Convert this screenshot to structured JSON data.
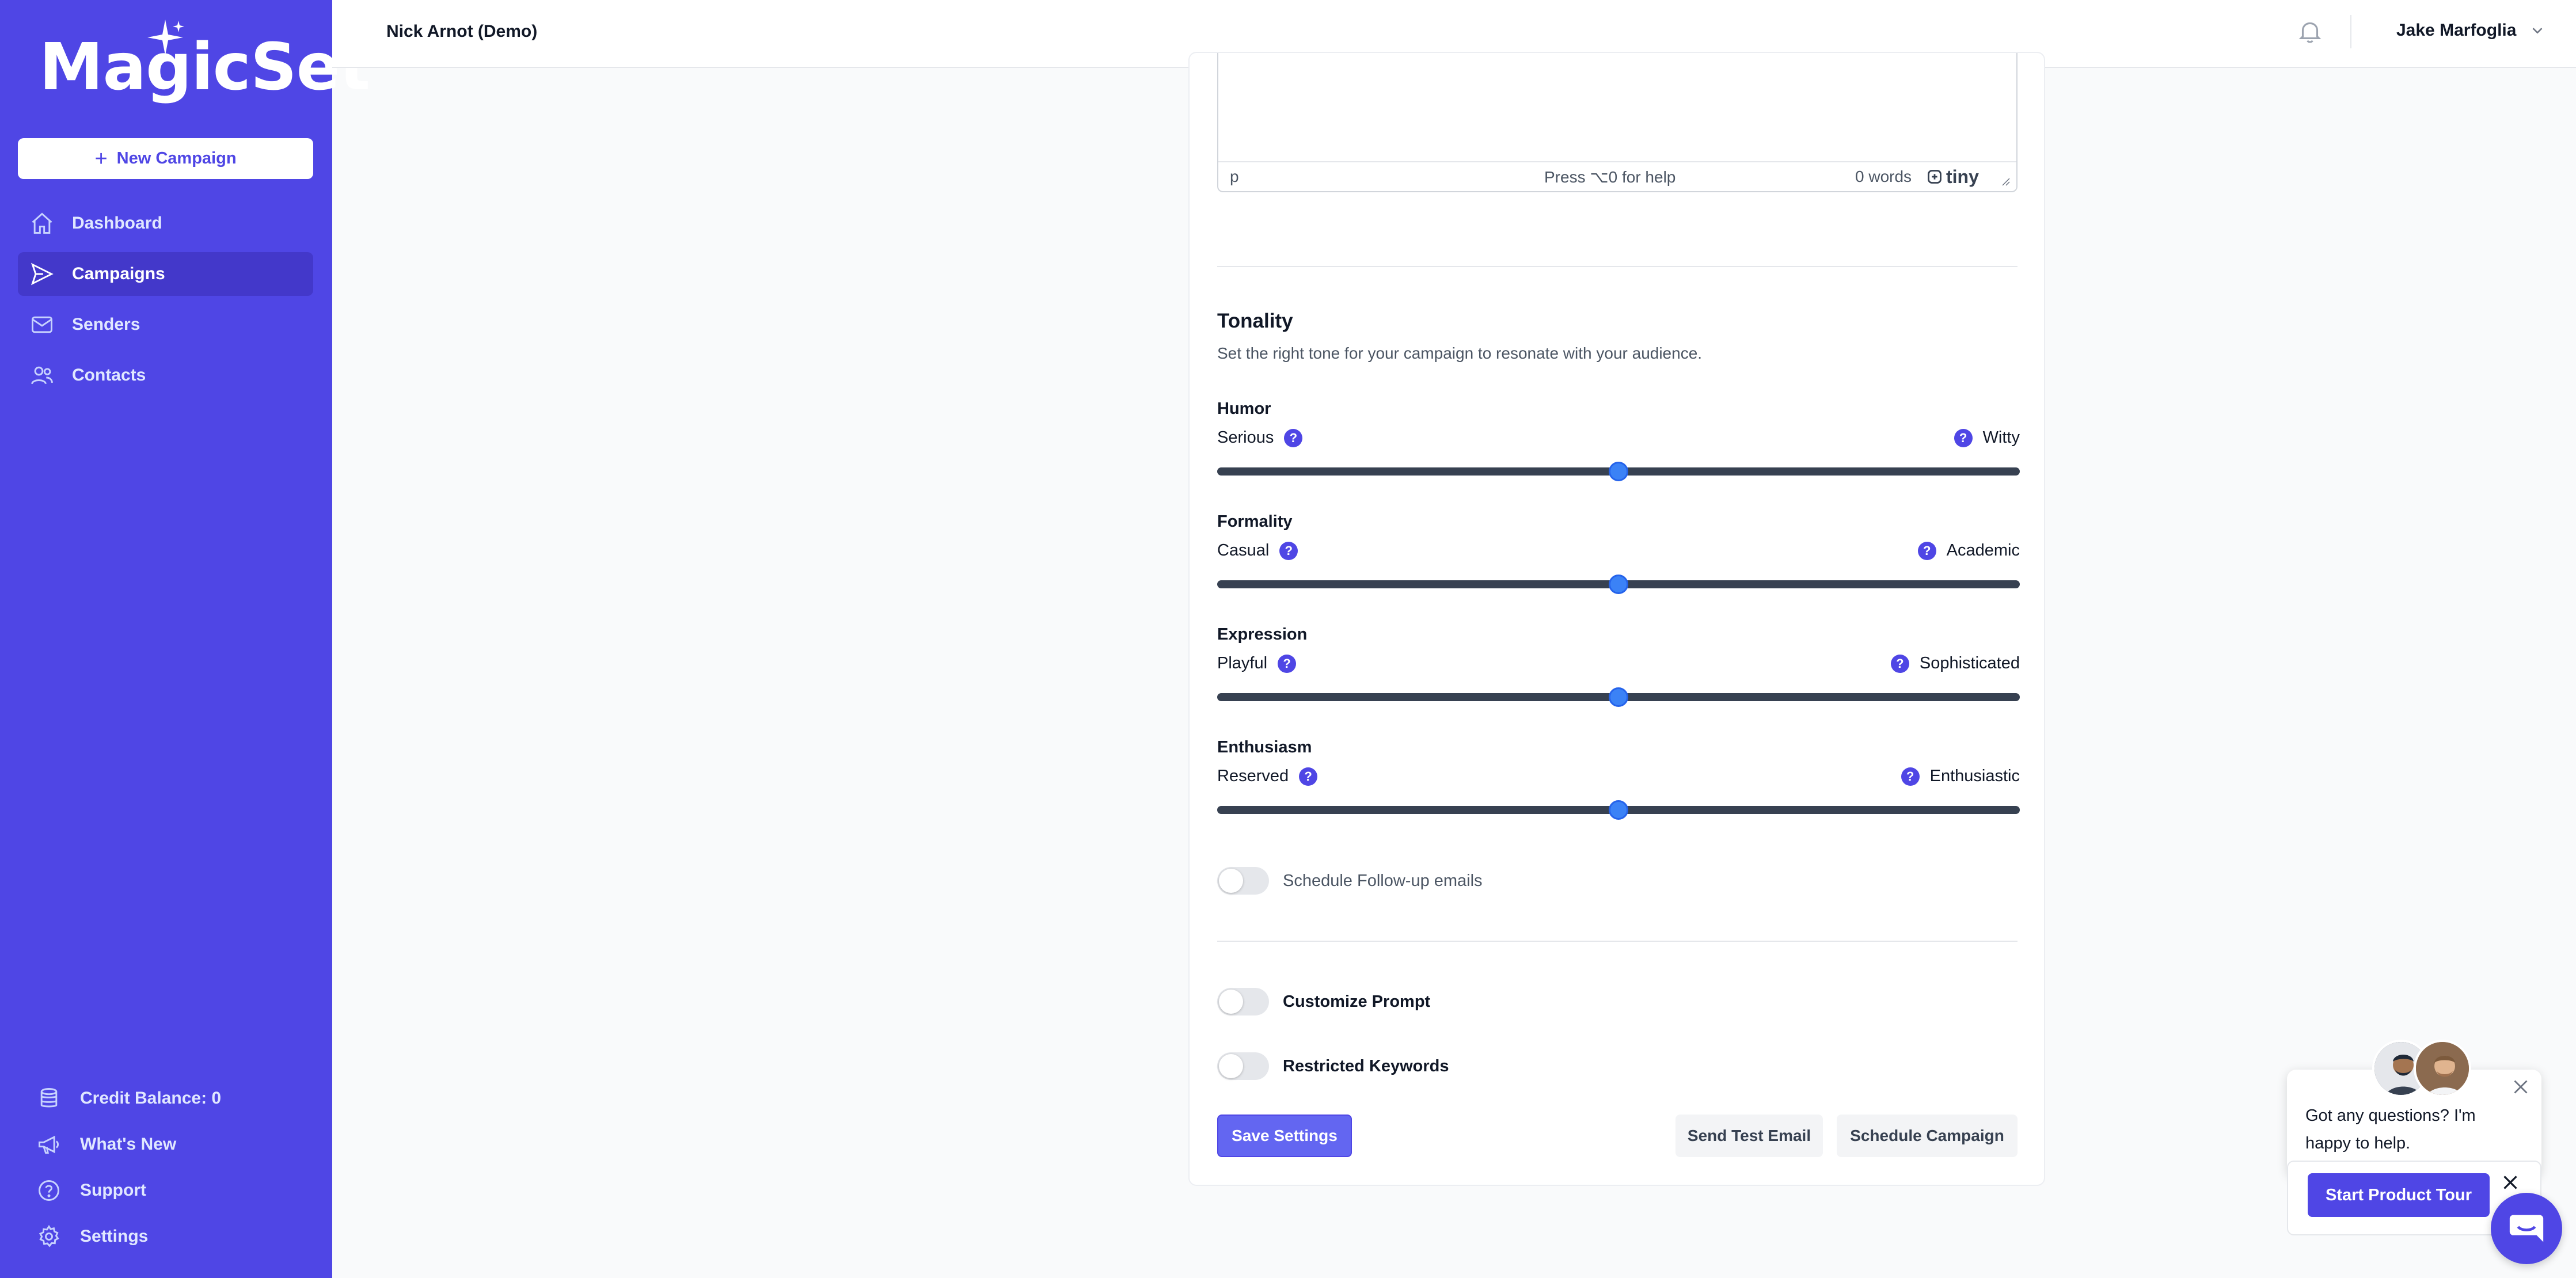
{
  "app": {
    "logo_text": "MagicSet",
    "brand_color": "#4f46e5",
    "accent_color": "#3b82f6"
  },
  "sidebar": {
    "new_campaign_label": "New Campaign",
    "items": [
      {
        "label": "Dashboard",
        "icon": "home-icon",
        "active": false
      },
      {
        "label": "Campaigns",
        "icon": "paper-plane-icon",
        "active": true
      },
      {
        "label": "Senders",
        "icon": "envelope-icon",
        "active": false
      },
      {
        "label": "Contacts",
        "icon": "users-icon",
        "active": false
      }
    ],
    "bottom_items": [
      {
        "label": "Credit Balance: 0",
        "icon": "database-icon"
      },
      {
        "label": "What's New",
        "icon": "megaphone-icon"
      },
      {
        "label": "Support",
        "icon": "question-circle-icon"
      },
      {
        "label": "Settings",
        "icon": "gear-icon"
      }
    ]
  },
  "header": {
    "org_name": "Nick Arnot (Demo)",
    "user_name": "Jake Marfoglia"
  },
  "editor": {
    "element_path": "p",
    "help_text": "Press ⌥0 for help",
    "word_count": "0 words",
    "brand": "tiny"
  },
  "tonality": {
    "title": "Tonality",
    "description": "Set the right tone for your campaign to resonate with your audience.",
    "sliders": [
      {
        "title": "Humor",
        "left": "Serious",
        "right": "Witty",
        "value": 0.5
      },
      {
        "title": "Formality",
        "left": "Casual",
        "right": "Academic",
        "value": 0.5
      },
      {
        "title": "Expression",
        "left": "Playful",
        "right": "Sophisticated",
        "value": 0.5
      },
      {
        "title": "Enthusiasm",
        "left": "Reserved",
        "right": "Enthusiastic",
        "value": 0.5
      }
    ],
    "help_mark": "?"
  },
  "toggles": {
    "follow_up": {
      "label": "Schedule Follow-up emails",
      "on": false
    },
    "customize_prompt": {
      "label": "Customize Prompt",
      "on": false
    },
    "restricted_keywords": {
      "label": "Restricted Keywords",
      "on": false
    }
  },
  "actions": {
    "save": "Save Settings",
    "test": "Send Test Email",
    "schedule": "Schedule Campaign"
  },
  "chat": {
    "message": "Got any questions? I'm happy to help.",
    "tour_button": "Start Product Tour"
  }
}
